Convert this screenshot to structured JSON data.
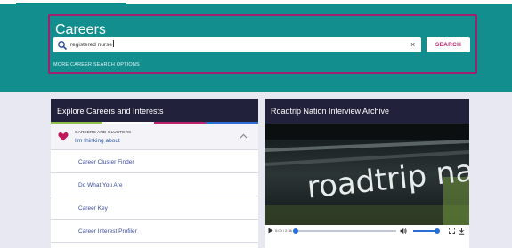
{
  "hero": {
    "title": "Careers",
    "search_value": "registered nurse",
    "clear_glyph": "×",
    "search_button": "SEARCH",
    "more_options": "MORE CAREER SEARCH OPTIONS",
    "highlight_color": "#a0206e",
    "background_color": "#138e8e"
  },
  "explore": {
    "title": "Explore Careers and Interests",
    "clusters_label": "CAREERS AND CLUSTERS",
    "clusters_sub": "I'm thinking about",
    "items": [
      {
        "label": "Career Cluster Finder"
      },
      {
        "label": "Do What You Are"
      },
      {
        "label": "Career Key"
      },
      {
        "label": "Career Interest Profiler"
      }
    ]
  },
  "video": {
    "title": "Roadtrip Nation Interview Archive",
    "time": "0:00 / 2:36",
    "progress": 0.0,
    "volume": 1.0
  },
  "icons": [
    "search-icon",
    "close-icon",
    "heart-icon",
    "chevron-up-icon",
    "play-icon",
    "volume-icon",
    "fullscreen-icon",
    "download-icon"
  ]
}
